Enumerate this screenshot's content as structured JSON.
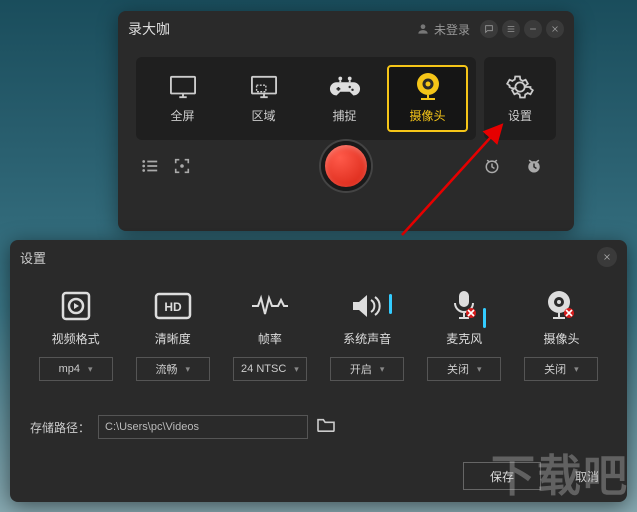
{
  "main": {
    "title": "录大咖",
    "user": "未登录",
    "modes": {
      "fullscreen": "全屏",
      "region": "区域",
      "capture": "捕捉",
      "camera": "摄像头"
    },
    "settings_label": "设置"
  },
  "settings": {
    "title": "设置",
    "cols": {
      "format": {
        "label": "视频格式",
        "value": "mp4"
      },
      "quality": {
        "label": "清晰度",
        "value": "流畅"
      },
      "fps": {
        "label": "帧率",
        "value": "24 NTSC"
      },
      "system_sound": {
        "label": "系统声音",
        "value": "开启"
      },
      "mic": {
        "label": "麦克风",
        "value": "关闭"
      },
      "camera": {
        "label": "摄像头",
        "value": "关闭"
      }
    },
    "path_label": "存储路径：",
    "path_value": "C:\\Users\\pc\\Videos",
    "save": "保存",
    "cancel": "取消"
  },
  "watermark": "下载吧"
}
